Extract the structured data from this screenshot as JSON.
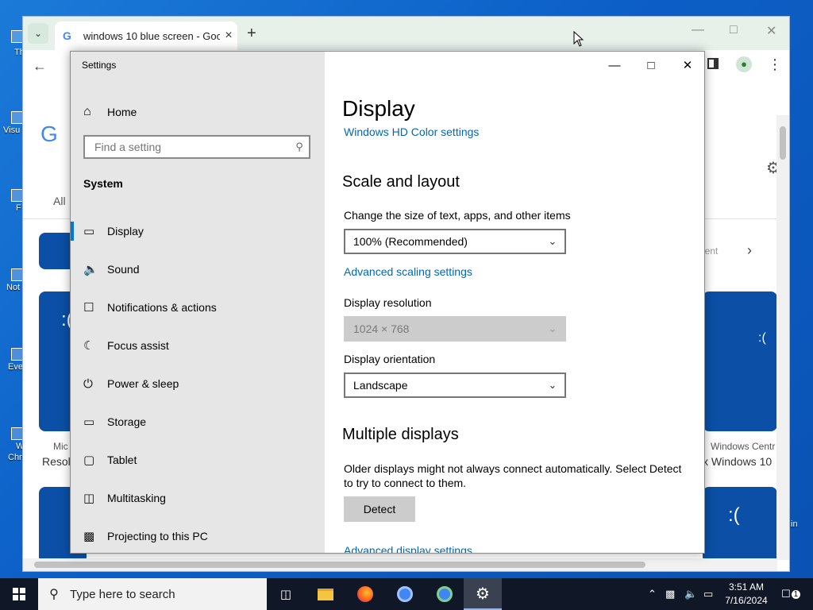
{
  "desktop": {
    "labels": [
      "Th",
      "Visu",
      "F",
      "Not",
      "Eve",
      "W",
      "Chr",
      "in"
    ]
  },
  "chrome": {
    "tab_title": "windows 10 blue screen - Goo",
    "page": {
      "all_tab": "All",
      "left_source": "Mic",
      "left_title": "Resol",
      "right_source": "Windows Centr",
      "right_title": "x Windows 10",
      "more_text": "ement"
    }
  },
  "settings": {
    "window_title": "Settings",
    "home_label": "Home",
    "search_placeholder": "Find a setting",
    "section": "System",
    "nav": [
      {
        "label": "Display",
        "icon": "monitor-icon"
      },
      {
        "label": "Sound",
        "icon": "speaker-icon"
      },
      {
        "label": "Notifications & actions",
        "icon": "notification-icon"
      },
      {
        "label": "Focus assist",
        "icon": "moon-icon"
      },
      {
        "label": "Power & sleep",
        "icon": "power-icon"
      },
      {
        "label": "Storage",
        "icon": "storage-icon"
      },
      {
        "label": "Tablet",
        "icon": "tablet-icon"
      },
      {
        "label": "Multitasking",
        "icon": "multitasking-icon"
      },
      {
        "label": "Projecting to this PC",
        "icon": "projecting-icon"
      }
    ],
    "content": {
      "title": "Display",
      "hd_color_link": "Windows HD Color settings",
      "scale_heading": "Scale and layout",
      "scale_label": "Change the size of text, apps, and other items",
      "scale_value": "100% (Recommended)",
      "advanced_scaling_link": "Advanced scaling settings",
      "resolution_label": "Display resolution",
      "resolution_value": "1024 × 768",
      "orientation_label": "Display orientation",
      "orientation_value": "Landscape",
      "multiple_heading": "Multiple displays",
      "multiple_text": "Older displays might not always connect automatically. Select Detect to try to connect to them.",
      "detect_button": "Detect",
      "advanced_display_link": "Advanced display settings"
    }
  },
  "taskbar": {
    "search_placeholder": "Type here to search",
    "time": "3:51 AM",
    "date": "7/16/2024",
    "notification_count": "1"
  },
  "colors": {
    "accent": "#0078d7",
    "link": "#0067b8",
    "taskbar": "#101828"
  }
}
